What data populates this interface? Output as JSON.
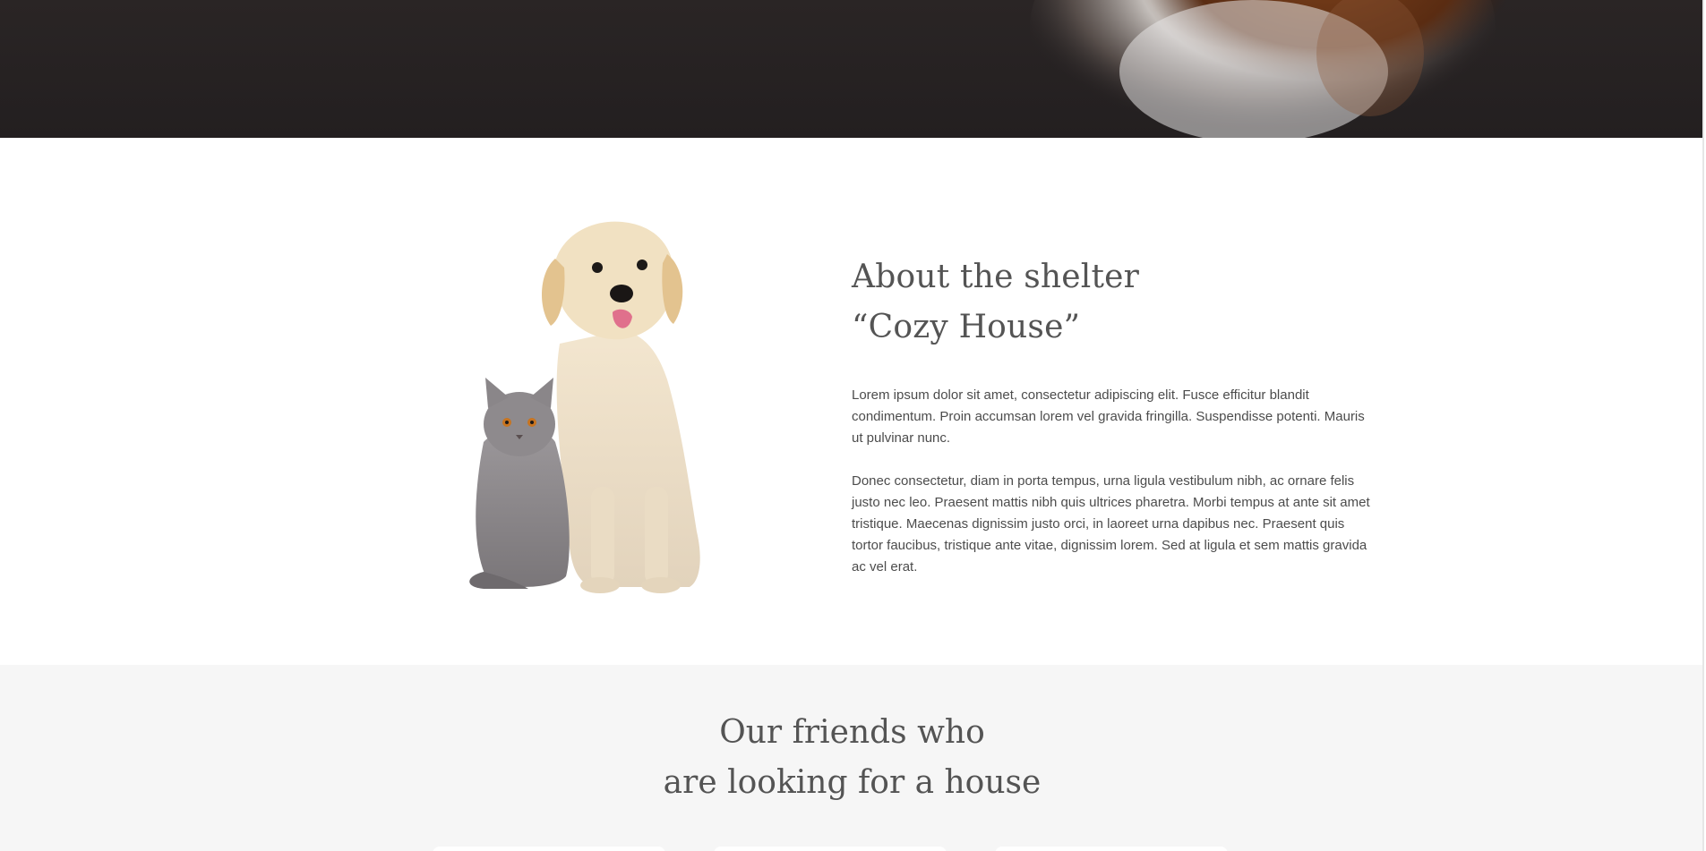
{
  "about": {
    "title_line1": "About the shelter",
    "title_line2": "“Cozy House”",
    "paragraph1": "Lorem ipsum dolor sit amet, consectetur adipiscing elit. Fusce efficitur blandit condimentum. Proin accumsan lorem vel gravida fringilla. Suspendisse potenti. Mauris ut pulvinar nunc.",
    "paragraph2": "Donec consectetur, diam in porta tempus, urna ligula vestibulum nibh, ac ornare felis justo nec leo. Praesent mattis nibh quis ultrices pharetra. Morbi tempus at ante sit amet tristique. Maecenas dignissim justo orci, in laoreet urna dapibus nec. Praesent quis tortor faucibus, tristique ante vitae, dignissim lorem. Sed at ligula et sem mattis gravida ac vel erat."
  },
  "friends": {
    "title_line1": "Our friends who",
    "title_line2": "are looking for a house",
    "cards": [
      "pet-card-1",
      "pet-card-2",
      "pet-card-3"
    ]
  },
  "colors": {
    "hero_background": "#231f20",
    "heading_text": "#545454",
    "body_text": "#4c4c4c",
    "friends_background": "#f6f6f6"
  },
  "icons": {
    "hero_photo": "pet-photo",
    "about_illustration": "dog-and-cat-illustration"
  }
}
